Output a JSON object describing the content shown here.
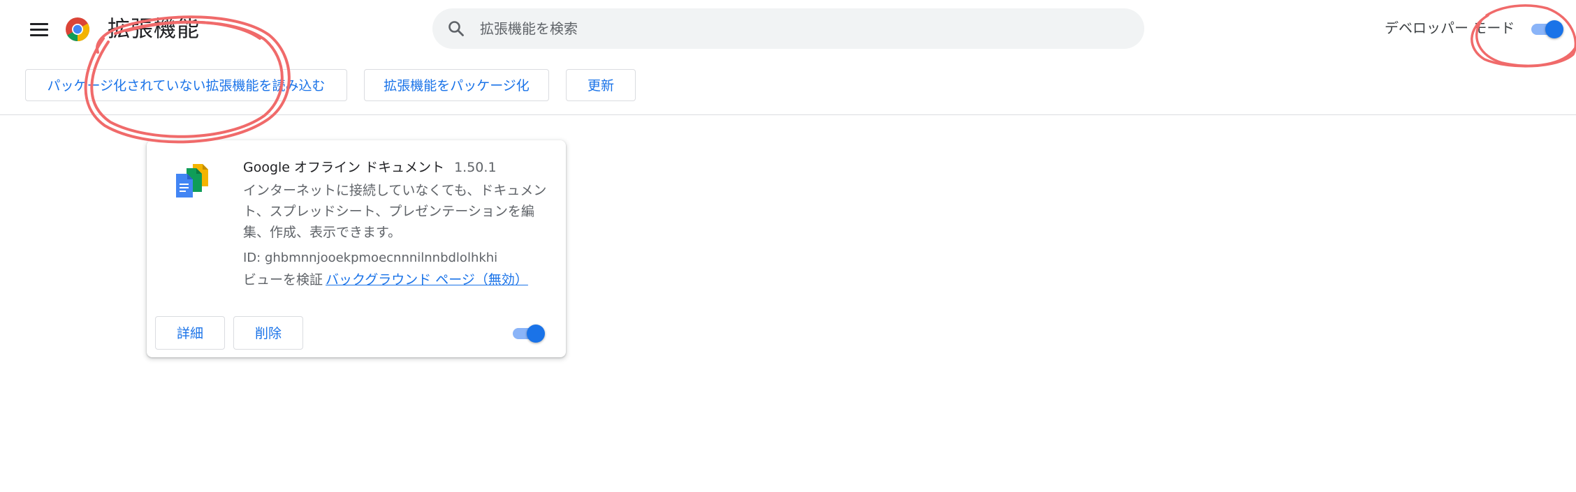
{
  "header": {
    "title": "拡張機能",
    "search_placeholder": "拡張機能を検索",
    "developer_mode_label": "デベロッパー モード",
    "developer_mode_on": true
  },
  "actions": {
    "load_unpacked": "パッケージ化されていない拡張機能を読み込む",
    "pack_extension": "拡張機能をパッケージ化",
    "update": "更新"
  },
  "extension": {
    "name": "Google オフライン ドキュメント",
    "version": "1.50.1",
    "description": "インターネットに接続していなくても、ドキュメント、スプレッドシート、プレゼンテーションを編集、作成、表示できます。",
    "id_line": "ID: ghbmnnjooekpmoecnnnilnnbdlolhkhi",
    "inspect_views_label": "ビューを検証",
    "background_page_link": "バックグラウンド ページ（無効）",
    "details_button": "詳細",
    "remove_button": "削除",
    "enabled": true
  },
  "colors": {
    "accent": "#1a73e8",
    "toggle_track": "#8ab4f8",
    "annotation_circle": "#f06a6a"
  },
  "icons": {
    "menu": "hamburger-menu-icon",
    "logo": "chrome-logo-icon",
    "search": "search-icon",
    "extension": "google-docs-offline-icon"
  }
}
